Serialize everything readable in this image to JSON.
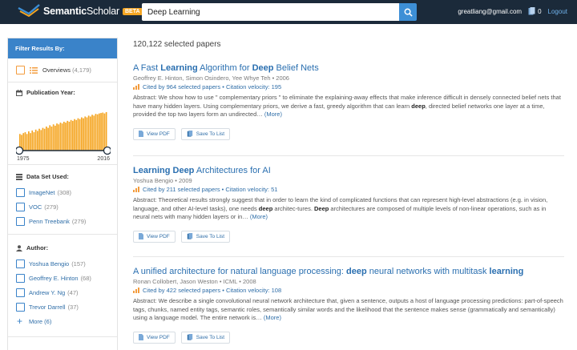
{
  "app": {
    "brand_bold": "Semantic",
    "brand_regular": "Scholar",
    "beta": "BETA",
    "colors": {
      "topbar": "#1b2a3a",
      "accent": "#3a83c9",
      "beta": "#f5a623",
      "histogram": "#f5a623"
    }
  },
  "search": {
    "value": "Deep Learning",
    "button_icon": "search-icon"
  },
  "user": {
    "email": "greatliang@gmail.com",
    "library_count": "0",
    "logout": "Logout"
  },
  "sidebar": {
    "header": "Filter Results By:",
    "overview": {
      "label": "Overviews",
      "count": "(4,179)"
    },
    "publication_year": {
      "title": "Publication Year:",
      "min_label": "1975",
      "max_label": "2016",
      "chart_data": {
        "type": "bar",
        "x_range": [
          1975,
          2016
        ],
        "values": [
          38,
          36,
          40,
          42,
          38,
          44,
          40,
          46,
          42,
          48,
          45,
          50,
          47,
          52,
          50,
          55,
          52,
          58,
          55,
          60,
          57,
          62,
          60,
          64,
          62,
          66,
          64,
          68,
          66,
          70,
          68,
          72,
          70,
          74,
          72,
          76,
          74,
          78,
          76,
          80,
          78,
          82,
          80,
          84,
          83,
          85,
          86,
          87,
          85,
          88
        ]
      }
    },
    "dataset": {
      "title": "Data Set Used:",
      "items": [
        {
          "label": "ImageNet",
          "count": "(308)"
        },
        {
          "label": "VOC",
          "count": "(279)"
        },
        {
          "label": "Penn Treebank",
          "count": "(279)"
        }
      ]
    },
    "author": {
      "title": "Author:",
      "items": [
        {
          "label": "Yoshua Bengio",
          "count": "(157)"
        },
        {
          "label": "Geoffrey E. Hinton",
          "count": "(68)"
        },
        {
          "label": "Andrew Y. Ng",
          "count": "(47)"
        },
        {
          "label": "Trevor Darrell",
          "count": "(37)"
        }
      ],
      "more": "More (6)"
    }
  },
  "results": {
    "total": "120,122 selected papers",
    "view_pdf": "View PDF",
    "save": "Save To List",
    "papers": [
      {
        "title_parts": [
          {
            "t": "A Fast ",
            "b": false
          },
          {
            "t": "Learning",
            "b": true
          },
          {
            "t": " Algorithm for ",
            "b": false
          },
          {
            "t": "Deep",
            "b": true
          },
          {
            "t": " Belief Nets",
            "b": false
          }
        ],
        "authors": "Geoffrey E. Hinton, Simon Osindero, Yee Whye Teh • 2006",
        "cite": "Cited by 964 selected papers • Citation velocity: 195",
        "abstract_parts": [
          {
            "t": "Abstract: We show how to use \" complementary priors \" to eliminate the explaining-away effects that make inference difficult in densely connected belief nets that have many hidden layers. Using complementary priors, we derive a fast, greedy algorithm that can learn ",
            "b": false
          },
          {
            "t": "deep",
            "b": true
          },
          {
            "t": ", directed belief networks one layer at a time, provided the top two layers form an undirected…",
            "b": false
          }
        ],
        "more": "(More)"
      },
      {
        "title_parts": [
          {
            "t": "Learning Deep",
            "b": true
          },
          {
            "t": " Architectures for AI",
            "b": false
          }
        ],
        "authors": "Yoshua Bengio • 2009",
        "cite": "Cited by 211 selected papers • Citation velocity: 51",
        "abstract_parts": [
          {
            "t": "Abstract: Theoretical results strongly suggest that in order to learn the kind of complicated functions that can represent high-level abstractions (e.g. in vision, language, and other AI-level tasks), one needs ",
            "b": false
          },
          {
            "t": "deep",
            "b": true
          },
          {
            "t": " architec-tures. ",
            "b": false
          },
          {
            "t": "Deep",
            "b": true
          },
          {
            "t": " architectures are composed of multiple levels of non-linear operations, such as in neural nets with many hidden layers or in…",
            "b": false
          }
        ],
        "more": "(More)"
      },
      {
        "title_parts": [
          {
            "t": "A unified architecture for natural language processing: ",
            "b": false
          },
          {
            "t": "deep",
            "b": true
          },
          {
            "t": " neural networks with multitask ",
            "b": false
          },
          {
            "t": "learning",
            "b": true
          }
        ],
        "authors": "Ronan Collobert, Jason Weston • ICML • 2008",
        "cite": "Cited by 422 selected papers • Citation velocity: 108",
        "abstract_parts": [
          {
            "t": "Abstract: We describe a single convolutional neural network architecture that, given a sentence, outputs a host of language processing predictions: part-of-speech tags, chunks, named entity tags, semantic roles, semantically similar words and the likelihood that the sentence makes sense (grammatically and semantically) using a language model. The entire network is…",
            "b": false
          }
        ],
        "more": "(More)"
      }
    ]
  }
}
